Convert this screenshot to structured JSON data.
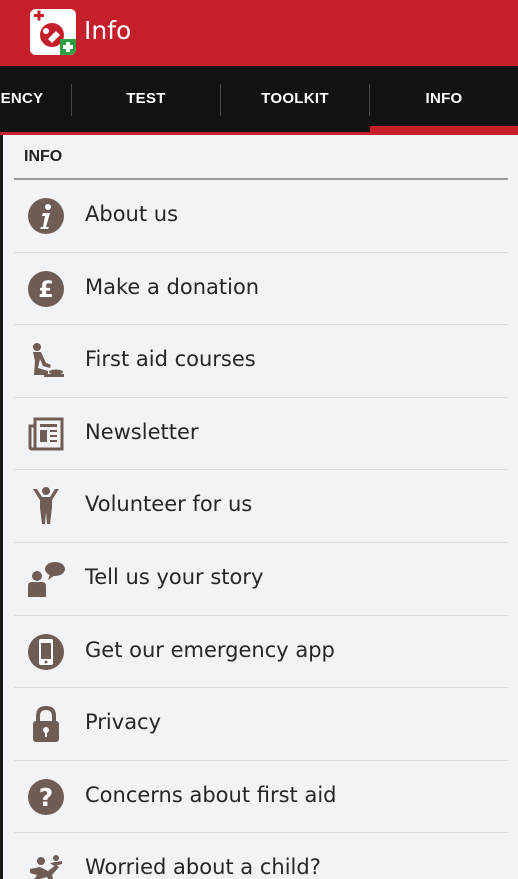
{
  "app_bar": {
    "title": "Info"
  },
  "tabs": [
    {
      "label": "ENCY"
    },
    {
      "label": "TEST"
    },
    {
      "label": "TOOLKIT"
    },
    {
      "label": "INFO"
    }
  ],
  "active_tab": "INFO",
  "section": {
    "header": "INFO"
  },
  "items": [
    {
      "label": "About us",
      "icon": "info-icon"
    },
    {
      "label": "Make a donation",
      "icon": "pound-icon"
    },
    {
      "label": "First aid courses",
      "icon": "first-aid-person-icon"
    },
    {
      "label": "Newsletter",
      "icon": "newspaper-icon"
    },
    {
      "label": "Volunteer for us",
      "icon": "volunteer-person-icon"
    },
    {
      "label": "Tell us your story",
      "icon": "speech-person-icon"
    },
    {
      "label": "Get our emergency app",
      "icon": "phone-icon"
    },
    {
      "label": "Privacy",
      "icon": "lock-icon"
    },
    {
      "label": "Concerns about first aid",
      "icon": "question-icon"
    },
    {
      "label": "Worried about a child?",
      "icon": "child-icon"
    }
  ],
  "colors": {
    "brand": "#c51f2b",
    "tab_bg": "#121212",
    "icon": "#6f5d55",
    "page_bg": "#f2f3f6"
  }
}
